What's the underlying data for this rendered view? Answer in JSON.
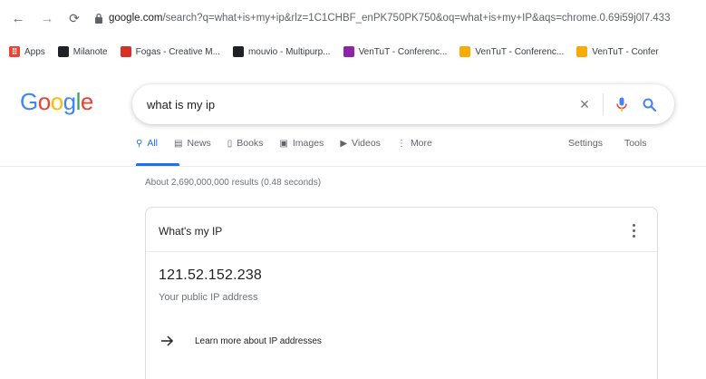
{
  "browser": {
    "url_host": "google.com",
    "url_rest": "/search?q=what+is+my+ip&rlz=1C1CHBF_enPK750PK750&oq=what+is+my+IP&aqs=chrome.0.69i59j0l7.433",
    "bookmarks": [
      {
        "label": "Apps",
        "color": "#ea4335"
      },
      {
        "label": "Milanote",
        "color": "#202124"
      },
      {
        "label": "Fogas - Creative M...",
        "color": "#d93025"
      },
      {
        "label": "mouvio - Multipurp...",
        "color": "#202124"
      },
      {
        "label": "VenTuT - Conferenc...",
        "color": "#8e24aa"
      },
      {
        "label": "VenTuT - Conferenc...",
        "color": "#f9ab00"
      },
      {
        "label": "VenTuT - Confer",
        "color": "#f9ab00"
      }
    ]
  },
  "search": {
    "logo": [
      "G",
      "o",
      "o",
      "g",
      "l",
      "e"
    ],
    "logo_colors": [
      "#4285f4",
      "#ea4335",
      "#fbbc05",
      "#4285f4",
      "#34a853",
      "#ea4335"
    ],
    "query": "what is my ip",
    "tabs": [
      {
        "label": "All",
        "icon": "search-icon",
        "glyph": "⚲"
      },
      {
        "label": "News",
        "icon": "news-icon",
        "glyph": "▤"
      },
      {
        "label": "Books",
        "icon": "books-icon",
        "glyph": "▯"
      },
      {
        "label": "Images",
        "icon": "images-icon",
        "glyph": "▣"
      },
      {
        "label": "Videos",
        "icon": "videos-icon",
        "glyph": "▶"
      },
      {
        "label": "More",
        "icon": "more-icon",
        "glyph": "⋮"
      }
    ],
    "settings_label": "Settings",
    "tools_label": "Tools",
    "result_stats": "About 2,690,000,000 results (0.48 seconds)"
  },
  "answer": {
    "title": "What's my IP",
    "ip": "121.52.152.238",
    "description": "Your public IP address",
    "learn_more": "Learn more about IP addresses"
  },
  "colors": {
    "accent": "#1a73e8"
  }
}
